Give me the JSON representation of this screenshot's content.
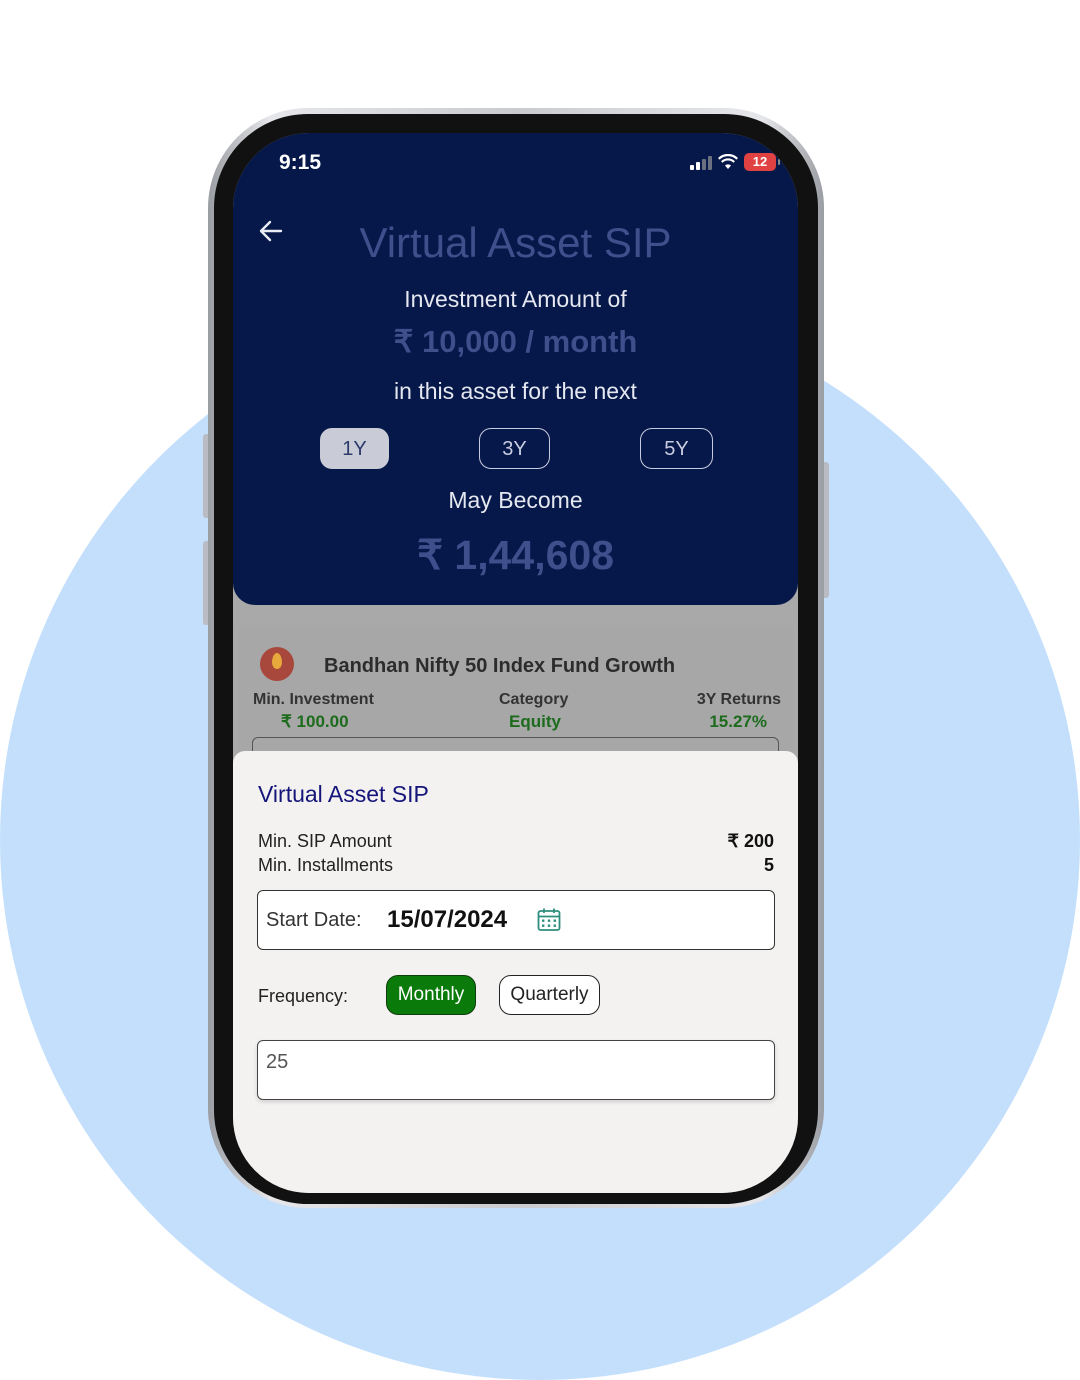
{
  "status_bar": {
    "time": "9:15",
    "battery": "12"
  },
  "header": {
    "title": "Virtual Asset SIP",
    "line1": "Investment Amount of",
    "amount": "₹ 10,000 / month",
    "line2": "in this asset for the next",
    "durations": [
      "1Y",
      "3Y",
      "5Y"
    ],
    "selected_duration": "1Y",
    "may_become_label": "May Become",
    "result": "₹ 1,44,608"
  },
  "fund": {
    "name": "Bandhan Nifty 50 Index Fund Growth",
    "stats": [
      {
        "label": "Min. Investment",
        "value": "₹ 100.00"
      },
      {
        "label": "Category",
        "value": "Equity"
      },
      {
        "label": "3Y Returns",
        "value": "15.27%"
      }
    ]
  },
  "sheet": {
    "title": "Virtual Asset SIP",
    "min_sip_label": "Min. SIP Amount",
    "min_sip_value": "₹ 200",
    "min_inst_label": "Min. Installments",
    "min_inst_value": "5",
    "start_date_label": "Start Date:",
    "start_date_value": "15/07/2024",
    "frequency_label": "Frequency:",
    "frequency_options": [
      "Monthly",
      "Quarterly"
    ],
    "selected_frequency": "Monthly",
    "installments_value": "25"
  },
  "colors": {
    "header_bg": "#061849",
    "accent_green": "#0a7a0a",
    "sheet_title": "#15157a",
    "background_circle": "#c4dffc"
  }
}
